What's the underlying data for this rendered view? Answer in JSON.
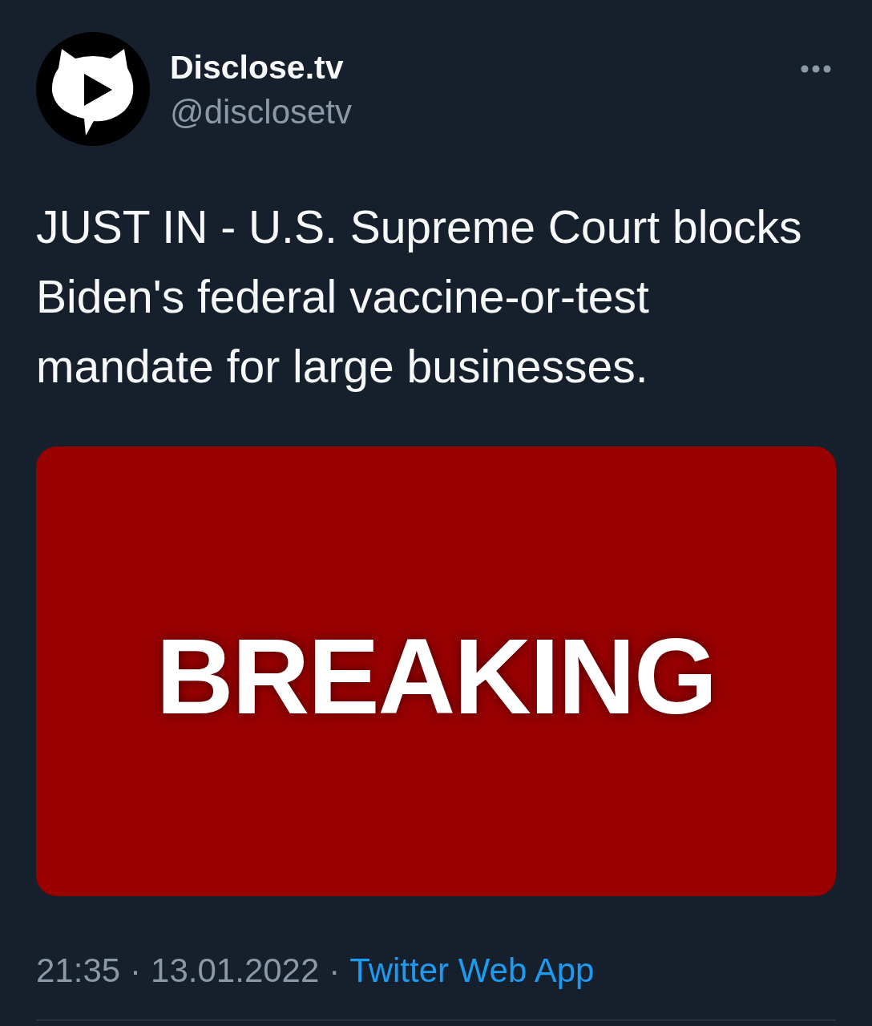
{
  "header": {
    "display_name": "Disclose.tv",
    "handle": "@disclosetv"
  },
  "tweet": {
    "text": "JUST IN - U.S. Supreme Court blocks Biden's federal vaccine-or-test mandate for large businesses."
  },
  "media": {
    "text": "BREAKING"
  },
  "meta": [
    {
      "kind": "text",
      "text": "21:35"
    },
    {
      "kind": "separator",
      "text": "·"
    },
    {
      "kind": "text",
      "text": "13.01.2022"
    },
    {
      "kind": "separator",
      "text": "·"
    },
    {
      "kind": "link",
      "text": "Twitter Web App"
    }
  ]
}
